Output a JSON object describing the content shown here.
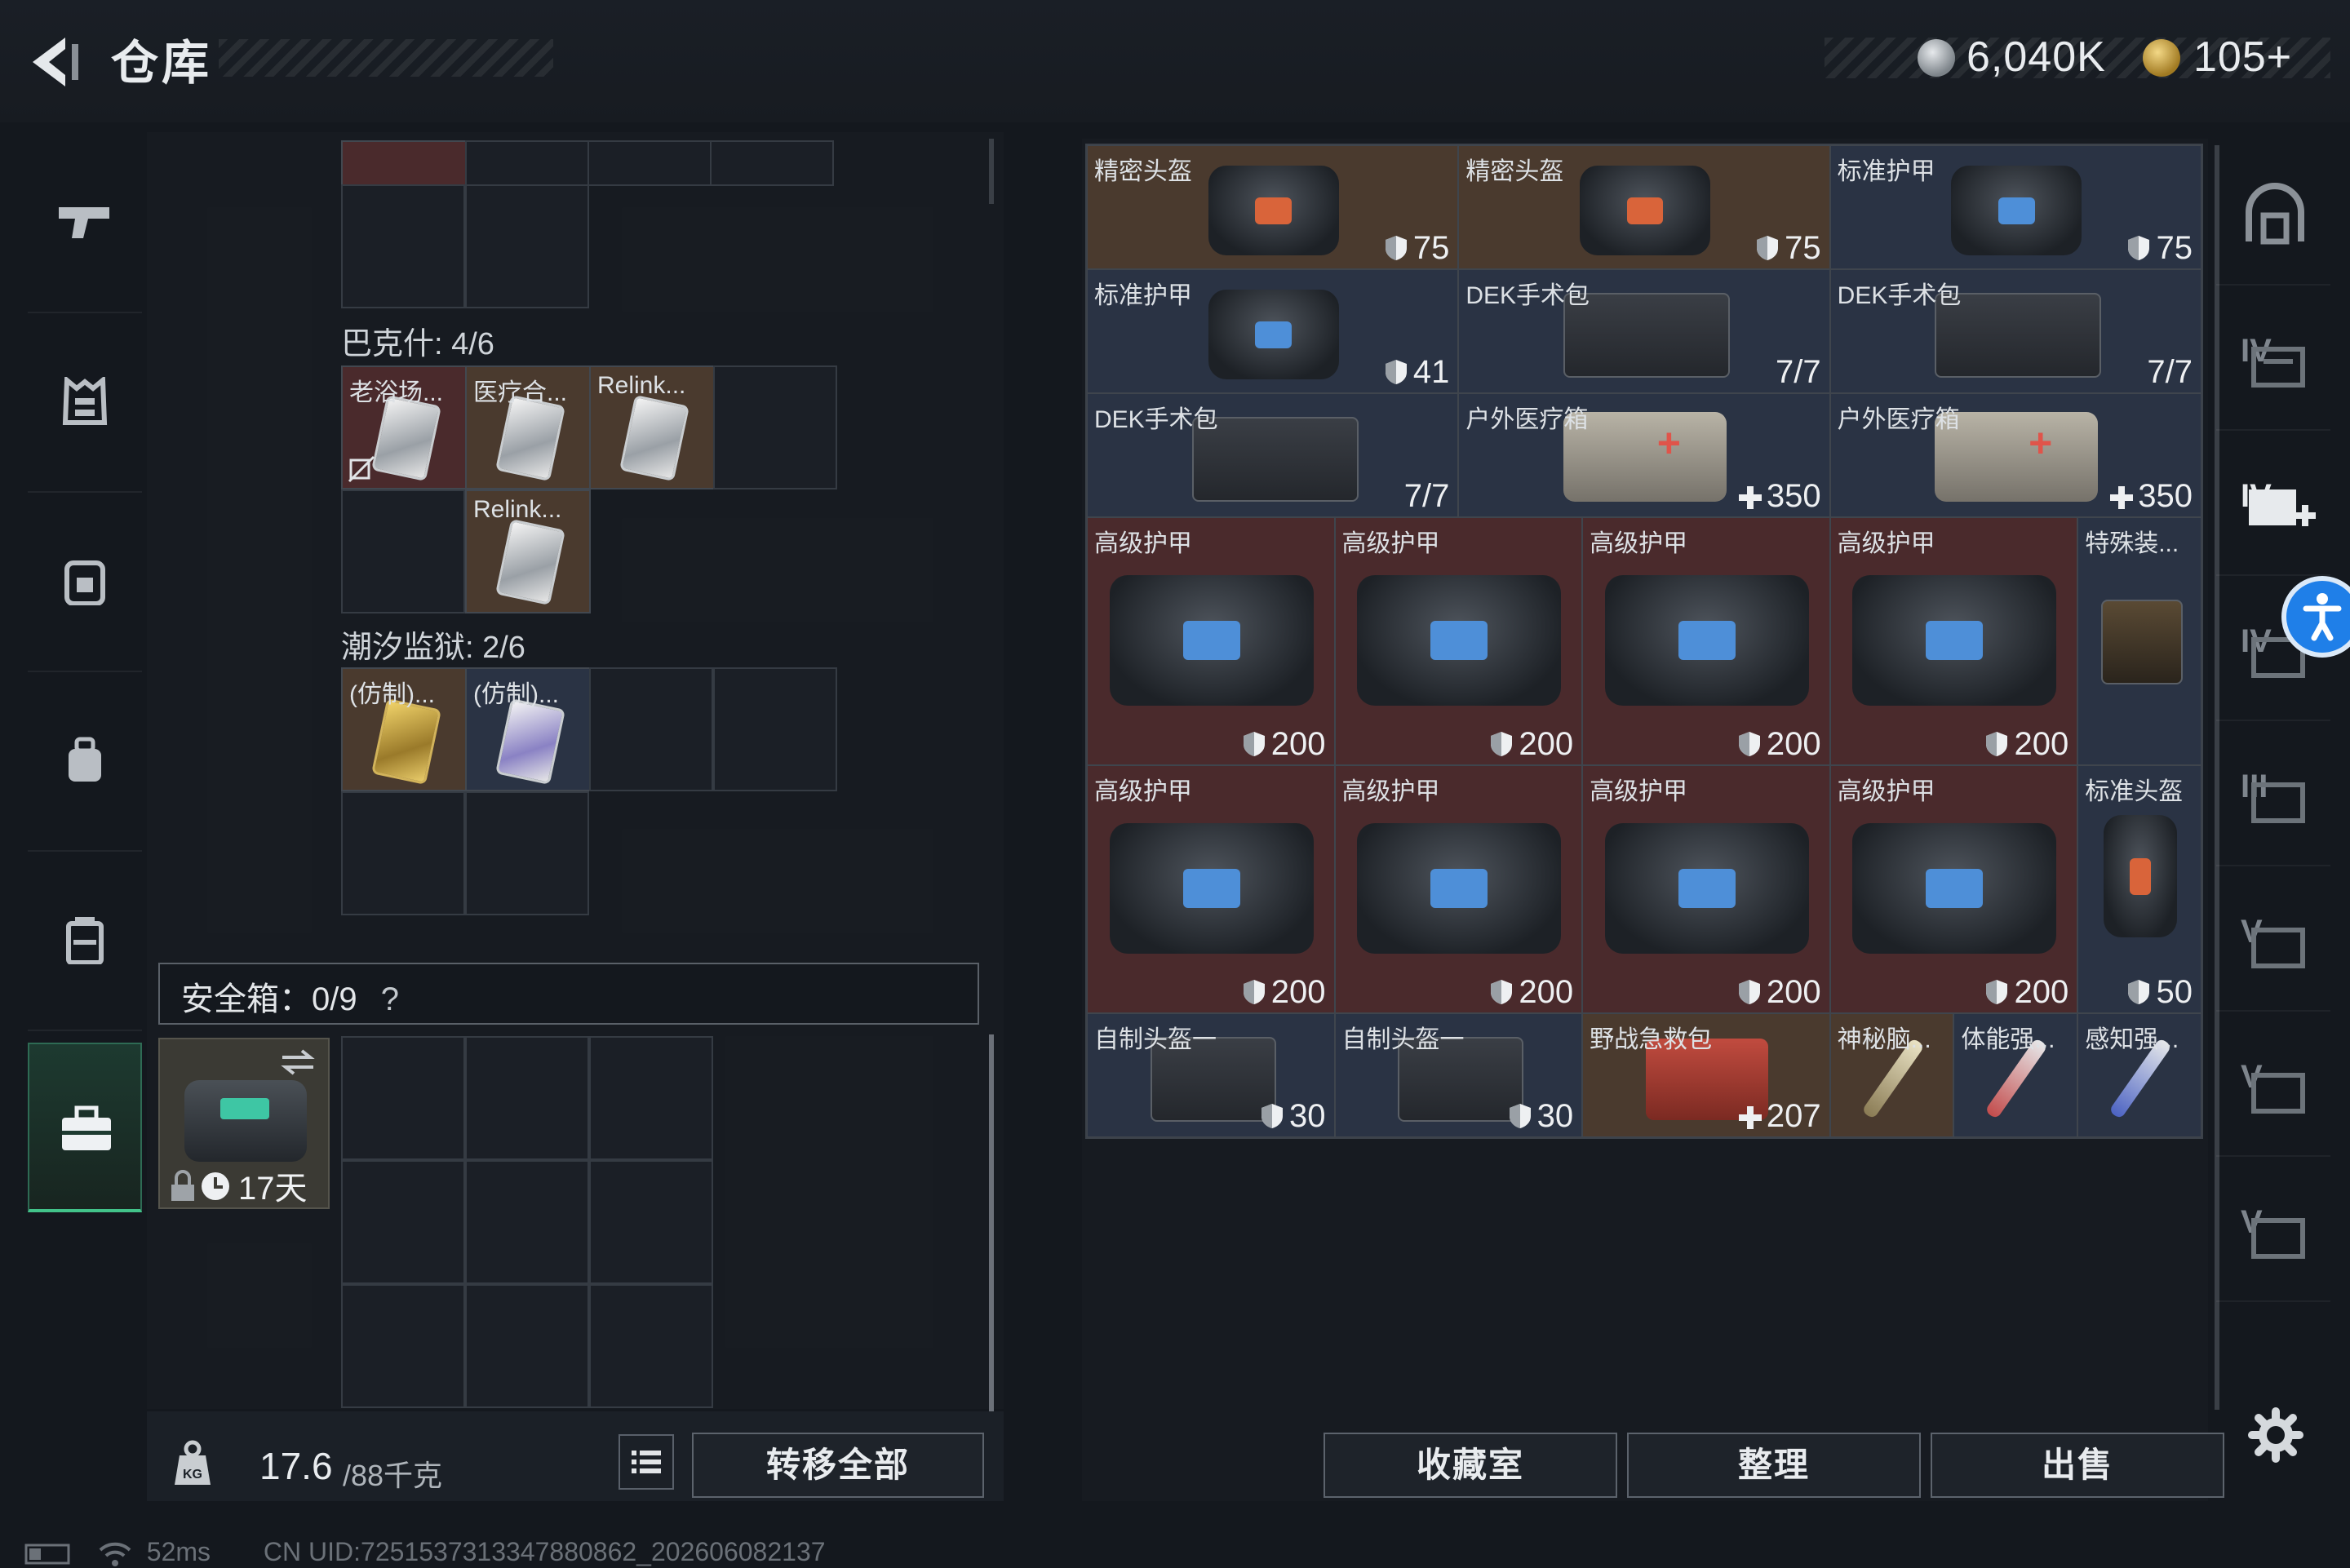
{
  "header": {
    "title": "仓库",
    "currency_silver": "6,040K",
    "currency_gold": "105+"
  },
  "left_rail": {
    "items": [
      {
        "icon": "pistol-icon"
      },
      {
        "icon": "vest-icon"
      },
      {
        "icon": "backpack-icon"
      },
      {
        "icon": "bag-icon"
      },
      {
        "icon": "container-icon"
      },
      {
        "icon": "briefcase-icon",
        "active": true
      }
    ]
  },
  "stash": {
    "section1_label": "巴克什: 4/6",
    "section1_items": [
      "老浴场...",
      "医疗合...",
      "Relink...",
      "Relink..."
    ],
    "section2_label": "潮汐监狱: 2/6",
    "section2_items": [
      "(仿制)...",
      "(仿制)..."
    ],
    "safe_box_label": "安全箱：0/9",
    "safe_box_help": "?",
    "case_days": "17天",
    "weight_value": "17.6",
    "weight_unit": "/88千克",
    "transfer_all": "转移全部"
  },
  "inventory": {
    "items": [
      {
        "name": "精密头盔",
        "value": "75"
      },
      {
        "name": "精密头盔",
        "value": "75"
      },
      {
        "name": "标准护甲",
        "value": "75"
      },
      {
        "name": "标准护甲",
        "value": "41"
      },
      {
        "name": "DEK手术包",
        "value": "7/7"
      },
      {
        "name": "DEK手术包",
        "value": "7/7"
      },
      {
        "name": "DEK手术包",
        "value": "7/7"
      },
      {
        "name": "户外医疗箱",
        "value": "350"
      },
      {
        "name": "户外医疗箱",
        "value": "350"
      },
      {
        "name": "高级护甲",
        "value": "200"
      },
      {
        "name": "高级护甲",
        "value": "200"
      },
      {
        "name": "高级护甲",
        "value": "200"
      },
      {
        "name": "高级护甲",
        "value": "200"
      },
      {
        "name": "特殊装...",
        "value": ""
      },
      {
        "name": "高级护甲",
        "value": "200"
      },
      {
        "name": "高级护甲",
        "value": "200"
      },
      {
        "name": "高级护甲",
        "value": "200"
      },
      {
        "name": "高级护甲",
        "value": "200"
      },
      {
        "name": "标准头盔",
        "value": "50"
      },
      {
        "name": "自制头盔一",
        "value": "30"
      },
      {
        "name": "自制头盔一",
        "value": "30"
      },
      {
        "name": "野战急救包",
        "value": "207"
      },
      {
        "name": "神秘脑...",
        "value": ""
      },
      {
        "name": "体能强...",
        "value": ""
      },
      {
        "name": "感知强...",
        "value": ""
      }
    ],
    "buttons": {
      "collection": "收藏室",
      "sort": "整理",
      "sell": "出售"
    }
  },
  "right_rail": {
    "items": [
      {
        "icon": "helmet-shelf-icon",
        "label": ""
      },
      {
        "icon": "rack-icon",
        "label": "IV"
      },
      {
        "icon": "add-storage-icon",
        "label": "IV"
      },
      {
        "icon": "rack-icon",
        "label": "IV"
      },
      {
        "icon": "rack-icon",
        "label": "III"
      },
      {
        "icon": "rack-icon",
        "label": "V"
      },
      {
        "icon": "rack-icon",
        "label": "V"
      },
      {
        "icon": "rack-icon",
        "label": "V"
      }
    ]
  },
  "status_bar": {
    "ping": "52ms",
    "uid": "CN UID:7251537313347880862_202606082137"
  },
  "colors": {
    "accent_green": "#42c38a",
    "high_armor_bg": "#4a2a2c",
    "brown_item_bg": "#4a3a2e",
    "blue_item_bg": "#2a3344",
    "accessibility_blue": "#1f7fe8"
  }
}
